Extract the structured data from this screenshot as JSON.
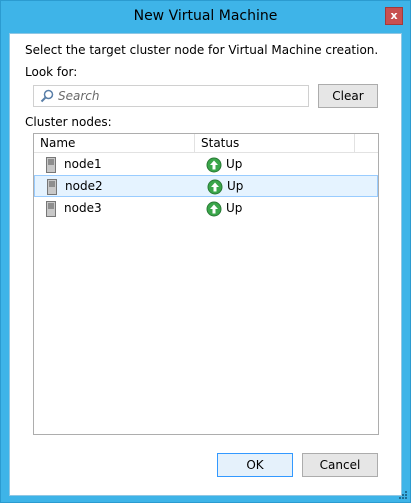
{
  "window": {
    "title": "New Virtual Machine",
    "close_glyph": "x"
  },
  "prompt_text": "Select the target cluster node for Virtual Machine creation.",
  "look_for_label": "Look for:",
  "search": {
    "placeholder": "Search",
    "value": "",
    "icon": "search-icon"
  },
  "clear_label": "Clear",
  "cluster_nodes_label": "Cluster nodes:",
  "table": {
    "columns": [
      "Name",
      "Status"
    ],
    "rows": [
      {
        "name": "node1",
        "status": "Up",
        "selected": false
      },
      {
        "name": "node2",
        "status": "Up",
        "selected": true
      },
      {
        "name": "node3",
        "status": "Up",
        "selected": false
      }
    ]
  },
  "buttons": {
    "ok": "OK",
    "cancel": "Cancel"
  },
  "colors": {
    "window_frame": "#3eb4e8",
    "selection": "#e5f3ff",
    "status_up": "#3aa64a"
  }
}
